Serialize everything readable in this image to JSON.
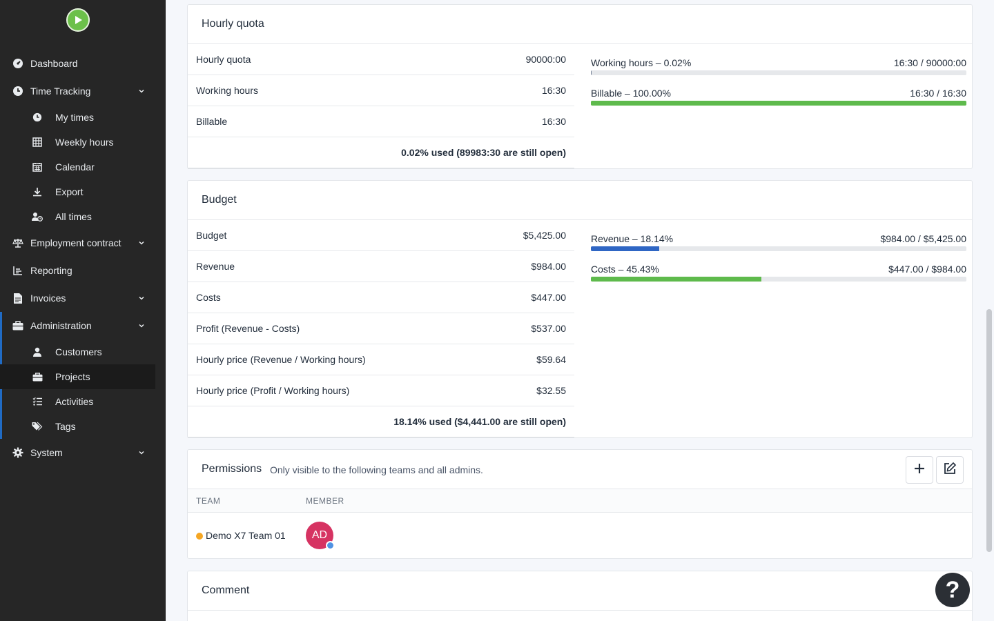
{
  "sidebar": {
    "logo_icon": "play-circle-icon",
    "items": [
      {
        "label": "Dashboard",
        "icon": "tachometer-icon"
      },
      {
        "label": "Time Tracking",
        "icon": "clock-icon"
      },
      {
        "label": "My times",
        "icon": "clock-icon"
      },
      {
        "label": "Weekly hours",
        "icon": "table-icon"
      },
      {
        "label": "Calendar",
        "icon": "calendar-icon"
      },
      {
        "label": "Export",
        "icon": "download-icon"
      },
      {
        "label": "All times",
        "icon": "user-clock-icon"
      },
      {
        "label": "Employment contract",
        "icon": "balance-scale-icon"
      },
      {
        "label": "Reporting",
        "icon": "chart-icon"
      },
      {
        "label": "Invoices",
        "icon": "invoice-icon"
      },
      {
        "label": "Administration",
        "icon": "briefcase-icon"
      },
      {
        "label": "Customers",
        "icon": "user-icon"
      },
      {
        "label": "Projects",
        "icon": "briefcase-icon"
      },
      {
        "label": "Activities",
        "icon": "tasks-icon"
      },
      {
        "label": "Tags",
        "icon": "tags-icon"
      },
      {
        "label": "System",
        "icon": "gear-icon"
      }
    ]
  },
  "hourly": {
    "title": "Hourly quota",
    "rows": [
      {
        "label": "Hourly quota",
        "value": "90000:00"
      },
      {
        "label": "Working hours",
        "value": "16:30"
      },
      {
        "label": "Billable",
        "value": "16:30"
      }
    ],
    "total": "0.02% used (89983:30 are still open)",
    "progress": [
      {
        "label": "Working hours – 0.02%",
        "value": "16:30 / 90000:00",
        "fraction": 0.0002,
        "color": "#6c7a91"
      },
      {
        "label": "Billable – 100.00%",
        "value": "16:30 / 16:30",
        "fraction": 1.0,
        "color": "#5eba4c"
      }
    ]
  },
  "budget": {
    "title": "Budget",
    "rows": [
      {
        "label": "Budget",
        "value": "$5,425.00"
      },
      {
        "label": "Revenue",
        "value": "$984.00"
      },
      {
        "label": "Costs",
        "value": "$447.00"
      },
      {
        "label": "Profit (Revenue - Costs)",
        "value": "$537.00"
      },
      {
        "label": "Hourly price (Revenue / Working hours)",
        "value": "$59.64"
      },
      {
        "label": "Hourly price (Profit / Working hours)",
        "value": "$32.55"
      }
    ],
    "total": "18.14% used ($4,441.00 are still open)",
    "progress": [
      {
        "label": "Revenue – 18.14%",
        "value": "$984.00 / $5,425.00",
        "fraction": 0.1814,
        "color": "#2f66c4"
      },
      {
        "label": "Costs – 45.43%",
        "value": "$447.00 / $984.00",
        "fraction": 0.4543,
        "color": "#5eba4c"
      }
    ]
  },
  "permissions": {
    "title": "Permissions",
    "subtitle": "Only visible to the following teams and all admins.",
    "add_icon": "plus-icon",
    "edit_icon": "edit-icon",
    "col_team": "TEAM",
    "col_member": "MEMBER",
    "team": "Demo X7 Team 01",
    "team_color": "#f5a623",
    "member_initials": "AD",
    "member_color": "#d63362"
  },
  "comment": {
    "title": "Comment"
  },
  "help": {
    "label": "?"
  }
}
